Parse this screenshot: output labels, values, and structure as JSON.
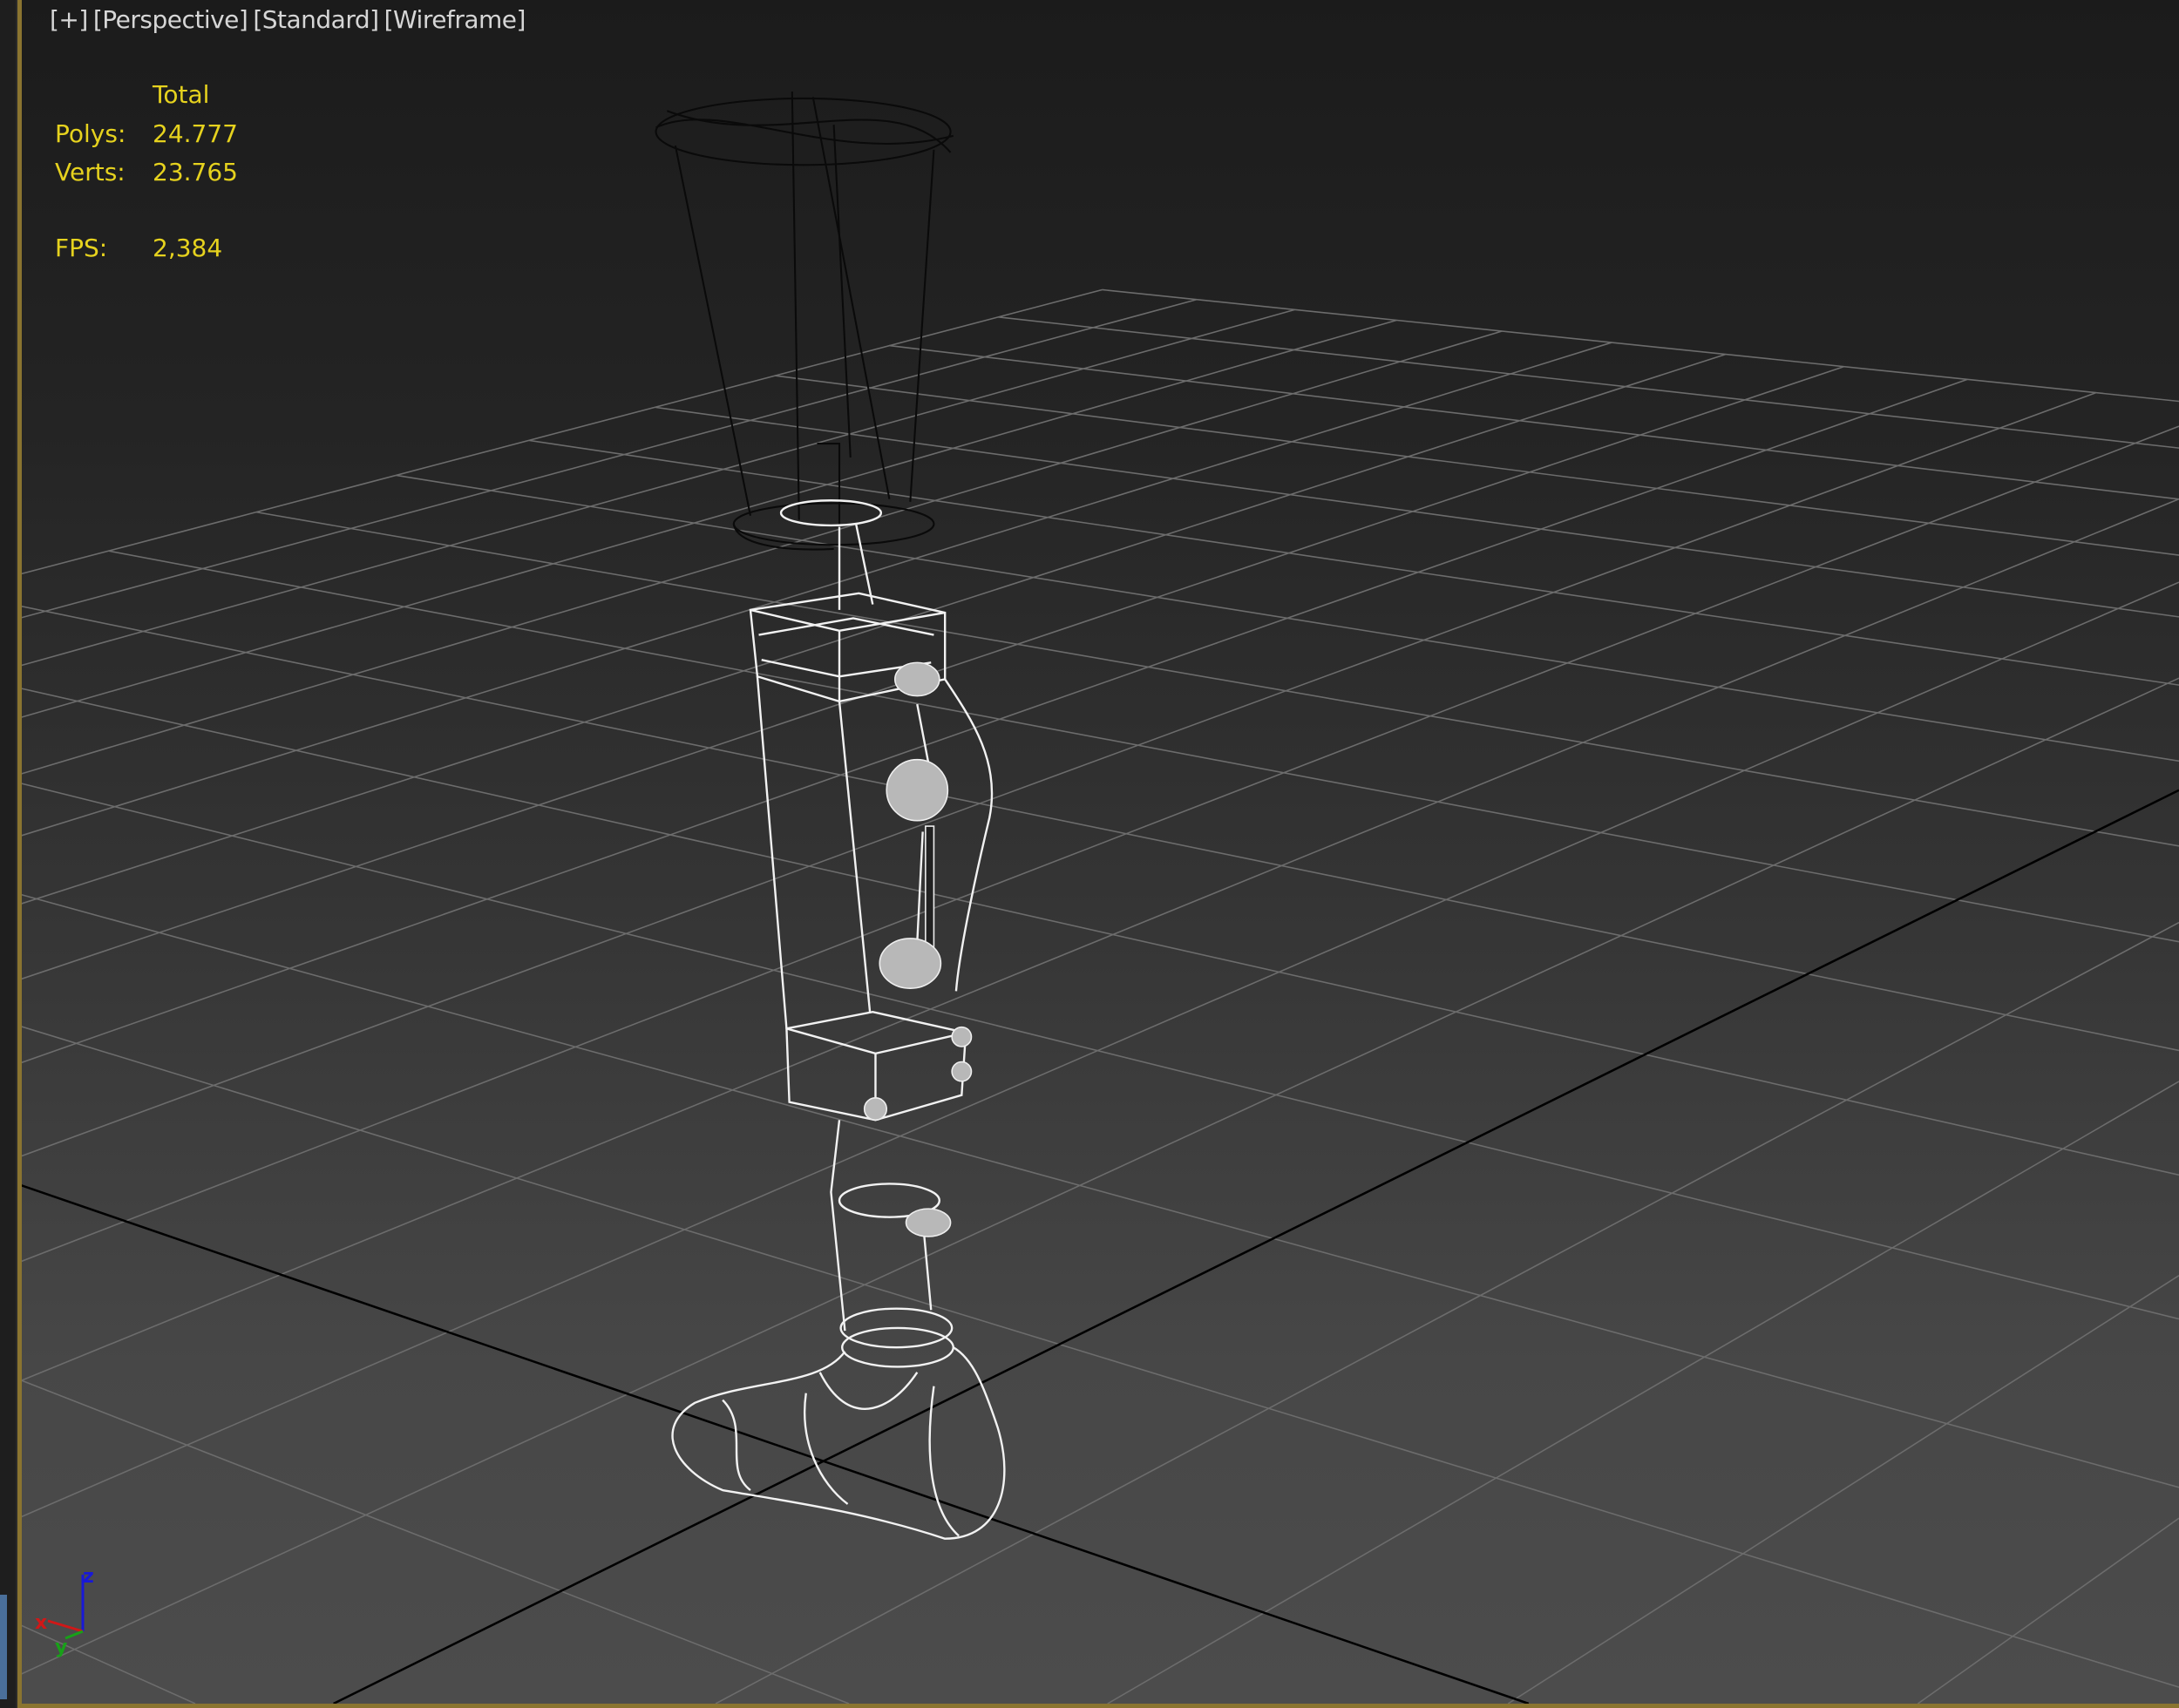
{
  "viewport": {
    "labels": [
      "[+]",
      "[Perspective]",
      "[Standard]",
      "[Wireframe]"
    ],
    "stats": {
      "header": "Total",
      "polys_label": "Polys:",
      "polys_value": "24.777",
      "verts_label": "Verts:",
      "verts_value": "23.765",
      "fps_label": "FPS:",
      "fps_value": "2,384"
    },
    "axis_gizmo": {
      "x": "x",
      "y": "y",
      "z": "z"
    }
  },
  "colors": {
    "stats_text": "#e6d21e",
    "label_text": "#d6d6d6",
    "border": "#8a7430",
    "grid": "#6c6c6c",
    "axis_x": "#d01818",
    "axis_y": "#18a018",
    "axis_z": "#1818d8"
  }
}
